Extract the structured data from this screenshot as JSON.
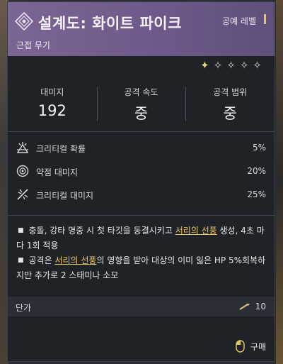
{
  "item": {
    "title": "설계도: 화이트 파이크",
    "category": "근접 무기",
    "craft_label": "공예 레벨",
    "rarity_stars_filled": 1,
    "rarity_stars_total": 5
  },
  "stats": [
    {
      "label": "대미지",
      "value": "192"
    },
    {
      "label": "공격 속도",
      "value": "중"
    },
    {
      "label": "공격 범위",
      "value": "중"
    }
  ],
  "properties": [
    {
      "icon": "crit-chance-icon",
      "label": "크리티컬 확률",
      "value": "5%"
    },
    {
      "icon": "weakspot-icon",
      "label": "약점 대미지",
      "value": "20%"
    },
    {
      "icon": "crit-damage-icon",
      "label": "크리티컬 대미지",
      "value": "25%"
    }
  ],
  "description": {
    "line1_a": "충돌, 강타 명중 시 첫 타깃을 동결시키고 ",
    "line1_hl": "서리의 선풍",
    "line1_b": " 생성, 4초 마다 1회 적용",
    "line2_a": "공격은 ",
    "line2_hl": "서리의 선풍",
    "line2_b": "의 영향을 받아 대상의 이미 잃은 HP 5%회복하지만 추가로 2 스태미나 소모"
  },
  "price": {
    "label": "단가",
    "amount": "10"
  },
  "buy_label": "구매",
  "colors": {
    "header": "#7b6593",
    "highlight": "#e8c45c",
    "panel": "#1f2227"
  }
}
